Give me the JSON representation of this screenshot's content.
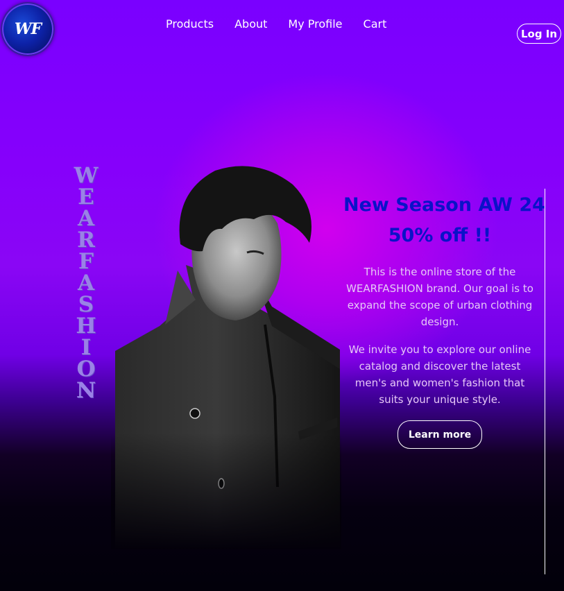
{
  "logo": {
    "text": "WF"
  },
  "nav": {
    "items": [
      "Products",
      "About",
      "My Profile",
      "Cart"
    ],
    "login_label": "Log In"
  },
  "brand_vertical": [
    "W",
    "E",
    "A",
    "R",
    "F",
    "A",
    "S",
    "H",
    "I",
    "O",
    "N"
  ],
  "hero": {
    "headline_1": "New Season AW 24",
    "headline_2": "50% off !!",
    "paragraph_1": "This is the online store of the WEARFASHION brand. Our goal is to expand the scope of urban clothing design.",
    "paragraph_2": "We invite you to explore our online catalog and discover the latest men's and women's fashion that suits your unique style.",
    "cta_label": "Learn more"
  },
  "colors": {
    "background_top": "#7a00ff",
    "glow": "#d100ee",
    "background_bottom": "#02000a",
    "headline": "#0a12c8",
    "brand_text": "#9a82e6",
    "body_text": "#e6c8f6"
  }
}
